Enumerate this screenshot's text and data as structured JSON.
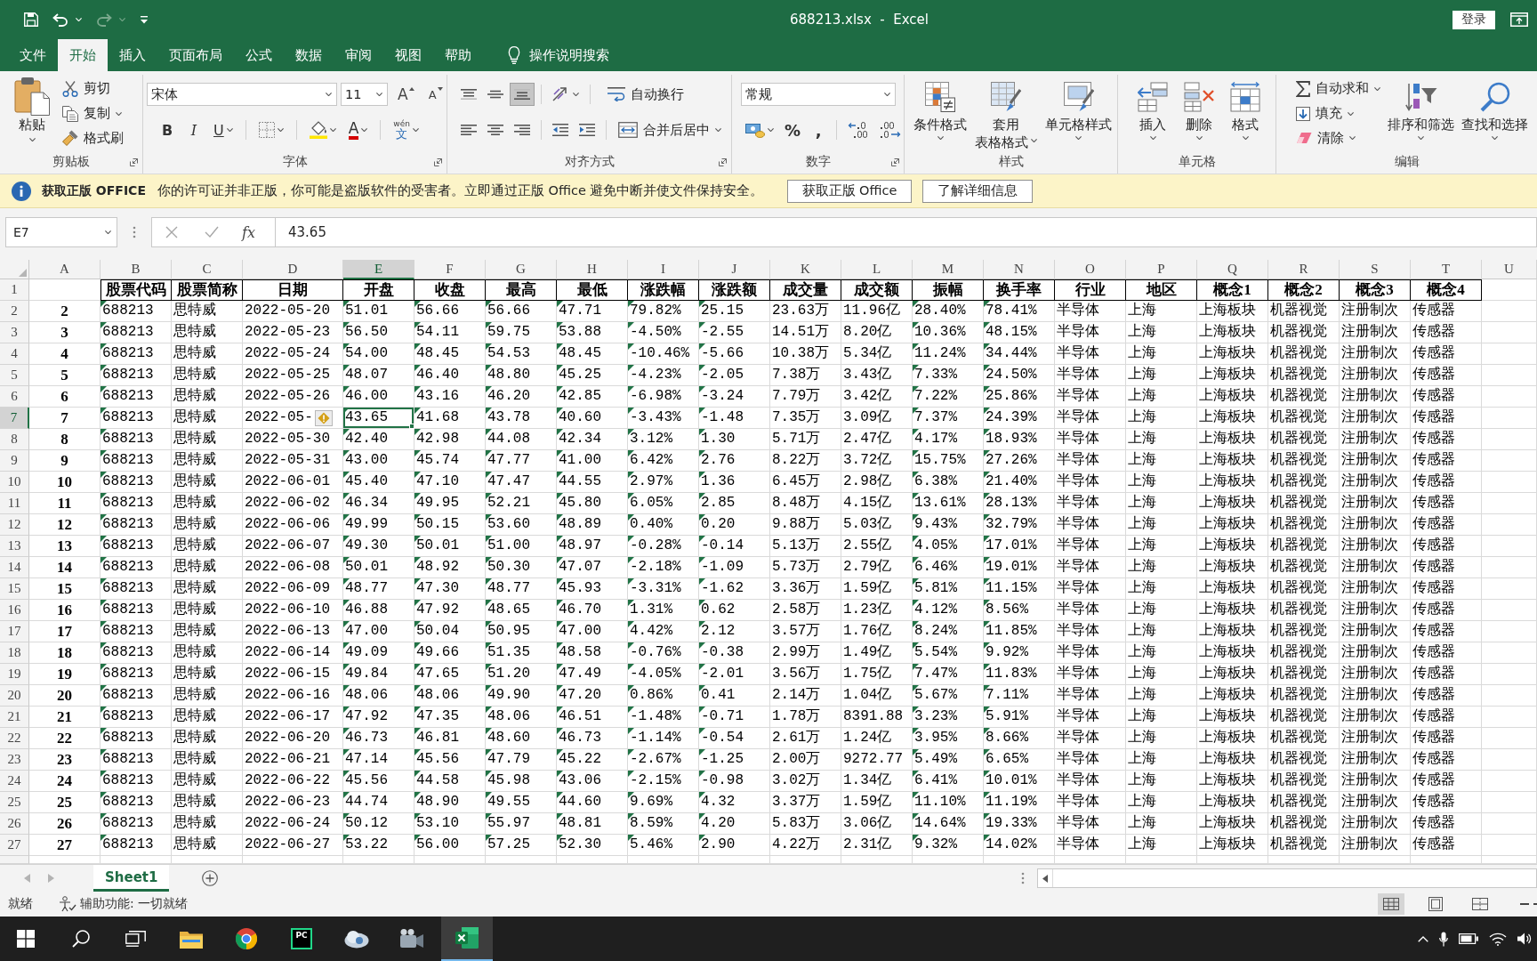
{
  "window": {
    "quick_access": [
      {
        "kind": "save",
        "disabled": false
      },
      {
        "kind": "undo",
        "disabled": false
      },
      {
        "kind": "redo",
        "disabled": true
      },
      {
        "kind": "customize",
        "disabled": false
      }
    ],
    "title": "688213.xlsx  -  Excel",
    "sign_in": "登录"
  },
  "tabs": [
    {
      "label": "文件",
      "selected": false
    },
    {
      "label": "开始",
      "selected": true
    },
    {
      "label": "插入",
      "selected": false
    },
    {
      "label": "页面布局",
      "selected": false
    },
    {
      "label": "公式",
      "selected": false
    },
    {
      "label": "数据",
      "selected": false
    },
    {
      "label": "审阅",
      "selected": false
    },
    {
      "label": "视图",
      "selected": false
    },
    {
      "label": "帮助",
      "selected": false
    }
  ],
  "tell_me": "操作说明搜索",
  "ribbon": {
    "clipboard": {
      "label": "剪贴板",
      "paste": "粘贴",
      "cut": "剪切",
      "copy": "复制",
      "format_painter": "格式刷"
    },
    "font": {
      "label": "字体",
      "font_name": "宋体",
      "font_size": "11",
      "grow": "A",
      "shrink": "A",
      "bold": "B",
      "italic": "I",
      "underline": "U",
      "font_color": "A",
      "phonetic_top": "wén",
      "phonetic_bottom": "文"
    },
    "alignment": {
      "label": "对齐方式",
      "vertical": [
        {
          "kind": "top",
          "selected": false
        },
        {
          "kind": "middle",
          "selected": false
        },
        {
          "kind": "bottom",
          "selected": true
        }
      ],
      "horizontal": [
        {
          "kind": "left",
          "selected": false
        },
        {
          "kind": "center",
          "selected": false
        },
        {
          "kind": "right",
          "selected": false
        }
      ],
      "wrap_text": "自动换行",
      "merge_center": "合并后居中"
    },
    "number": {
      "label": "数字",
      "format": "常规",
      "percent": "%",
      "comma": ","
    },
    "styles": {
      "label": "样式",
      "conditional": "条件格式",
      "table_format": [
        "套用",
        "表格格式"
      ],
      "cell_styles": "单元格样式"
    },
    "cells": {
      "label": "单元格",
      "insert": "插入",
      "delete": "删除",
      "format": "格式"
    },
    "editing": {
      "label": "编辑",
      "autosum": "自动求和",
      "fill": "填充",
      "clear": "清除",
      "sort_filter": "排序和筛选",
      "find_select": "查找和选择"
    }
  },
  "message_bar": {
    "title": "获取正版 OFFICE",
    "text": "你的许可证并非正版，你可能是盗版软件的受害者。立即通过正版 Office 避免中断并使文件保持安全。",
    "buttons": [
      "获取正版 Office",
      "了解详细信息"
    ]
  },
  "formula_bar": {
    "name_box": "E7",
    "function_button": "fx",
    "value": "43.65"
  },
  "grid": {
    "heading_row": "1",
    "smart_tag": true,
    "columns": [
      {
        "letter": "A",
        "kind": "index",
        "selected": false
      },
      {
        "letter": "B",
        "heading": "股票代码",
        "kind": "number-text",
        "selected": false
      },
      {
        "letter": "C",
        "heading": "股票简称",
        "kind": "text",
        "selected": false
      },
      {
        "letter": "D",
        "heading": "日期",
        "kind": "text",
        "selected": false
      },
      {
        "letter": "E",
        "heading": "开盘",
        "kind": "number-text",
        "selected": true
      },
      {
        "letter": "F",
        "heading": "收盘",
        "kind": "number-text",
        "selected": false
      },
      {
        "letter": "G",
        "heading": "最高",
        "kind": "number-text",
        "selected": false
      },
      {
        "letter": "H",
        "heading": "最低",
        "kind": "number-text",
        "selected": false
      },
      {
        "letter": "I",
        "heading": "涨跌幅",
        "kind": "number-text",
        "selected": false
      },
      {
        "letter": "J",
        "heading": "涨跌额",
        "kind": "number-text",
        "selected": false
      },
      {
        "letter": "K",
        "heading": "成交量",
        "kind": "text",
        "selected": false
      },
      {
        "letter": "L",
        "heading": "成交额",
        "kind": "text",
        "selected": false
      },
      {
        "letter": "M",
        "heading": "振幅",
        "kind": "number-text",
        "selected": false
      },
      {
        "letter": "N",
        "heading": "换手率",
        "kind": "number-text",
        "selected": false
      },
      {
        "letter": "O",
        "heading": "行业",
        "kind": "text",
        "selected": false
      },
      {
        "letter": "P",
        "heading": "地区",
        "kind": "text",
        "selected": false
      },
      {
        "letter": "Q",
        "heading": "概念1",
        "kind": "text",
        "selected": false
      },
      {
        "letter": "R",
        "heading": "概念2",
        "kind": "text",
        "selected": false
      },
      {
        "letter": "S",
        "heading": "概念3",
        "kind": "text",
        "selected": false
      },
      {
        "letter": "T",
        "heading": "概念4",
        "kind": "text",
        "selected": false
      },
      {
        "letter": "U",
        "kind": "text",
        "selected": false
      }
    ],
    "rows": [
      {
        "number": "2",
        "selected": false,
        "cells": [
          "2",
          "688213",
          "思特威",
          "2022-05-20",
          "51.01",
          "56.66",
          "56.66",
          "47.71",
          "79.82%",
          "25.15",
          "23.63万",
          "11.96亿",
          "28.40%",
          "78.41%",
          "半导体",
          "上海",
          "上海板块",
          "机器视觉",
          "注册制次",
          "传感器"
        ]
      },
      {
        "number": "3",
        "selected": false,
        "cells": [
          "3",
          "688213",
          "思特威",
          "2022-05-23",
          "56.50",
          "54.11",
          "59.75",
          "53.88",
          "-4.50%",
          "-2.55",
          "14.51万",
          "8.20亿",
          "10.36%",
          "48.15%",
          "半导体",
          "上海",
          "上海板块",
          "机器视觉",
          "注册制次",
          "传感器"
        ]
      },
      {
        "number": "4",
        "selected": false,
        "cells": [
          "4",
          "688213",
          "思特威",
          "2022-05-24",
          "54.00",
          "48.45",
          "54.53",
          "48.45",
          "-10.46%",
          "-5.66",
          "10.38万",
          "5.34亿",
          "11.24%",
          "34.44%",
          "半导体",
          "上海",
          "上海板块",
          "机器视觉",
          "注册制次",
          "传感器"
        ]
      },
      {
        "number": "5",
        "selected": false,
        "cells": [
          "5",
          "688213",
          "思特威",
          "2022-05-25",
          "48.07",
          "46.40",
          "48.80",
          "45.25",
          "-4.23%",
          "-2.05",
          "7.38万",
          "3.43亿",
          "7.33%",
          "24.50%",
          "半导体",
          "上海",
          "上海板块",
          "机器视觉",
          "注册制次",
          "传感器"
        ]
      },
      {
        "number": "6",
        "selected": false,
        "cells": [
          "6",
          "688213",
          "思特威",
          "2022-05-26",
          "46.00",
          "43.16",
          "46.20",
          "42.85",
          "-6.98%",
          "-3.24",
          "7.79万",
          "3.42亿",
          "7.22%",
          "25.86%",
          "半导体",
          "上海",
          "上海板块",
          "机器视觉",
          "注册制次",
          "传感器"
        ]
      },
      {
        "number": "7",
        "selected": true,
        "cells": [
          "7",
          "688213",
          "思特威",
          "2022-05-",
          "43.65",
          "41.68",
          "43.78",
          "40.60",
          "-3.43%",
          "-1.48",
          "7.35万",
          "3.09亿",
          "7.37%",
          "24.39%",
          "半导体",
          "上海",
          "上海板块",
          "机器视觉",
          "注册制次",
          "传感器"
        ]
      },
      {
        "number": "8",
        "selected": false,
        "cells": [
          "8",
          "688213",
          "思特威",
          "2022-05-30",
          "42.40",
          "42.98",
          "44.08",
          "42.34",
          "3.12%",
          "1.30",
          "5.71万",
          "2.47亿",
          "4.17%",
          "18.93%",
          "半导体",
          "上海",
          "上海板块",
          "机器视觉",
          "注册制次",
          "传感器"
        ]
      },
      {
        "number": "9",
        "selected": false,
        "cells": [
          "9",
          "688213",
          "思特威",
          "2022-05-31",
          "43.00",
          "45.74",
          "47.77",
          "41.00",
          "6.42%",
          "2.76",
          "8.22万",
          "3.72亿",
          "15.75%",
          "27.26%",
          "半导体",
          "上海",
          "上海板块",
          "机器视觉",
          "注册制次",
          "传感器"
        ]
      },
      {
        "number": "10",
        "selected": false,
        "cells": [
          "10",
          "688213",
          "思特威",
          "2022-06-01",
          "45.40",
          "47.10",
          "47.47",
          "44.55",
          "2.97%",
          "1.36",
          "6.45万",
          "2.98亿",
          "6.38%",
          "21.40%",
          "半导体",
          "上海",
          "上海板块",
          "机器视觉",
          "注册制次",
          "传感器"
        ]
      },
      {
        "number": "11",
        "selected": false,
        "cells": [
          "11",
          "688213",
          "思特威",
          "2022-06-02",
          "46.34",
          "49.95",
          "52.21",
          "45.80",
          "6.05%",
          "2.85",
          "8.48万",
          "4.15亿",
          "13.61%",
          "28.13%",
          "半导体",
          "上海",
          "上海板块",
          "机器视觉",
          "注册制次",
          "传感器"
        ]
      },
      {
        "number": "12",
        "selected": false,
        "cells": [
          "12",
          "688213",
          "思特威",
          "2022-06-06",
          "49.99",
          "50.15",
          "53.60",
          "48.89",
          "0.40%",
          "0.20",
          "9.88万",
          "5.03亿",
          "9.43%",
          "32.79%",
          "半导体",
          "上海",
          "上海板块",
          "机器视觉",
          "注册制次",
          "传感器"
        ]
      },
      {
        "number": "13",
        "selected": false,
        "cells": [
          "13",
          "688213",
          "思特威",
          "2022-06-07",
          "49.30",
          "50.01",
          "51.00",
          "48.97",
          "-0.28%",
          "-0.14",
          "5.13万",
          "2.55亿",
          "4.05%",
          "17.01%",
          "半导体",
          "上海",
          "上海板块",
          "机器视觉",
          "注册制次",
          "传感器"
        ]
      },
      {
        "number": "14",
        "selected": false,
        "cells": [
          "14",
          "688213",
          "思特威",
          "2022-06-08",
          "50.01",
          "48.92",
          "50.30",
          "47.07",
          "-2.18%",
          "-1.09",
          "5.73万",
          "2.79亿",
          "6.46%",
          "19.01%",
          "半导体",
          "上海",
          "上海板块",
          "机器视觉",
          "注册制次",
          "传感器"
        ]
      },
      {
        "number": "15",
        "selected": false,
        "cells": [
          "15",
          "688213",
          "思特威",
          "2022-06-09",
          "48.77",
          "47.30",
          "48.77",
          "45.93",
          "-3.31%",
          "-1.62",
          "3.36万",
          "1.59亿",
          "5.81%",
          "11.15%",
          "半导体",
          "上海",
          "上海板块",
          "机器视觉",
          "注册制次",
          "传感器"
        ]
      },
      {
        "number": "16",
        "selected": false,
        "cells": [
          "16",
          "688213",
          "思特威",
          "2022-06-10",
          "46.88",
          "47.92",
          "48.65",
          "46.70",
          "1.31%",
          "0.62",
          "2.58万",
          "1.23亿",
          "4.12%",
          "8.56%",
          "半导体",
          "上海",
          "上海板块",
          "机器视觉",
          "注册制次",
          "传感器"
        ]
      },
      {
        "number": "17",
        "selected": false,
        "cells": [
          "17",
          "688213",
          "思特威",
          "2022-06-13",
          "47.00",
          "50.04",
          "50.95",
          "47.00",
          "4.42%",
          "2.12",
          "3.57万",
          "1.76亿",
          "8.24%",
          "11.85%",
          "半导体",
          "上海",
          "上海板块",
          "机器视觉",
          "注册制次",
          "传感器"
        ]
      },
      {
        "number": "18",
        "selected": false,
        "cells": [
          "18",
          "688213",
          "思特威",
          "2022-06-14",
          "49.09",
          "49.66",
          "51.35",
          "48.58",
          "-0.76%",
          "-0.38",
          "2.99万",
          "1.49亿",
          "5.54%",
          "9.92%",
          "半导体",
          "上海",
          "上海板块",
          "机器视觉",
          "注册制次",
          "传感器"
        ]
      },
      {
        "number": "19",
        "selected": false,
        "cells": [
          "19",
          "688213",
          "思特威",
          "2022-06-15",
          "49.84",
          "47.65",
          "51.20",
          "47.49",
          "-4.05%",
          "-2.01",
          "3.56万",
          "1.75亿",
          "7.47%",
          "11.83%",
          "半导体",
          "上海",
          "上海板块",
          "机器视觉",
          "注册制次",
          "传感器"
        ]
      },
      {
        "number": "20",
        "selected": false,
        "cells": [
          "20",
          "688213",
          "思特威",
          "2022-06-16",
          "48.06",
          "48.06",
          "49.90",
          "47.20",
          "0.86%",
          "0.41",
          "2.14万",
          "1.04亿",
          "5.67%",
          "7.11%",
          "半导体",
          "上海",
          "上海板块",
          "机器视觉",
          "注册制次",
          "传感器"
        ]
      },
      {
        "number": "21",
        "selected": false,
        "cells": [
          "21",
          "688213",
          "思特威",
          "2022-06-17",
          "47.92",
          "47.35",
          "48.06",
          "46.51",
          "-1.48%",
          "-0.71",
          "1.78万",
          "8391.88",
          "3.23%",
          "5.91%",
          "半导体",
          "上海",
          "上海板块",
          "机器视觉",
          "注册制次",
          "传感器"
        ]
      },
      {
        "number": "22",
        "selected": false,
        "cells": [
          "22",
          "688213",
          "思特威",
          "2022-06-20",
          "46.73",
          "46.81",
          "48.60",
          "46.73",
          "-1.14%",
          "-0.54",
          "2.61万",
          "1.24亿",
          "3.95%",
          "8.66%",
          "半导体",
          "上海",
          "上海板块",
          "机器视觉",
          "注册制次",
          "传感器"
        ]
      },
      {
        "number": "23",
        "selected": false,
        "cells": [
          "23",
          "688213",
          "思特威",
          "2022-06-21",
          "47.14",
          "45.56",
          "47.79",
          "45.22",
          "-2.67%",
          "-1.25",
          "2.00万",
          "9272.77",
          "5.49%",
          "6.65%",
          "半导体",
          "上海",
          "上海板块",
          "机器视觉",
          "注册制次",
          "传感器"
        ]
      },
      {
        "number": "24",
        "selected": false,
        "cells": [
          "24",
          "688213",
          "思特威",
          "2022-06-22",
          "45.56",
          "44.58",
          "45.98",
          "43.06",
          "-2.15%",
          "-0.98",
          "3.02万",
          "1.34亿",
          "6.41%",
          "10.01%",
          "半导体",
          "上海",
          "上海板块",
          "机器视觉",
          "注册制次",
          "传感器"
        ]
      },
      {
        "number": "25",
        "selected": false,
        "cells": [
          "25",
          "688213",
          "思特威",
          "2022-06-23",
          "44.74",
          "48.90",
          "49.55",
          "44.60",
          "9.69%",
          "4.32",
          "3.37万",
          "1.59亿",
          "11.10%",
          "11.19%",
          "半导体",
          "上海",
          "上海板块",
          "机器视觉",
          "注册制次",
          "传感器"
        ]
      },
      {
        "number": "26",
        "selected": false,
        "cells": [
          "26",
          "688213",
          "思特威",
          "2022-06-24",
          "50.12",
          "53.10",
          "55.97",
          "48.81",
          "8.59%",
          "4.20",
          "5.83万",
          "3.06亿",
          "14.64%",
          "19.33%",
          "半导体",
          "上海",
          "上海板块",
          "机器视觉",
          "注册制次",
          "传感器"
        ]
      },
      {
        "number": "27",
        "selected": false,
        "cells": [
          "27",
          "688213",
          "思特威",
          "2022-06-27",
          "53.22",
          "56.00",
          "57.25",
          "52.30",
          "5.46%",
          "2.90",
          "4.22万",
          "2.31亿",
          "9.32%",
          "14.02%",
          "半导体",
          "上海",
          "上海板块",
          "机器视觉",
          "注册制次",
          "传感器"
        ]
      }
    ]
  },
  "sheets": [
    {
      "name": "Sheet1",
      "selected": true
    }
  ],
  "status_bar": {
    "text": "就绪",
    "accessibility": "辅助功能: 一切就绪",
    "views": [
      {
        "kind": "normal",
        "selected": true
      },
      {
        "kind": "page-layout",
        "selected": false
      },
      {
        "kind": "page-break",
        "selected": false
      }
    ]
  },
  "taskbar": {
    "apps": [
      {
        "kind": "folder",
        "active": false
      },
      {
        "kind": "browser",
        "active": false
      },
      {
        "kind": "ide",
        "label": "PC",
        "active": false
      },
      {
        "kind": "cloud",
        "active": false
      },
      {
        "kind": "camera",
        "active": false
      },
      {
        "kind": "spreadsheet",
        "active": true
      }
    ]
  }
}
